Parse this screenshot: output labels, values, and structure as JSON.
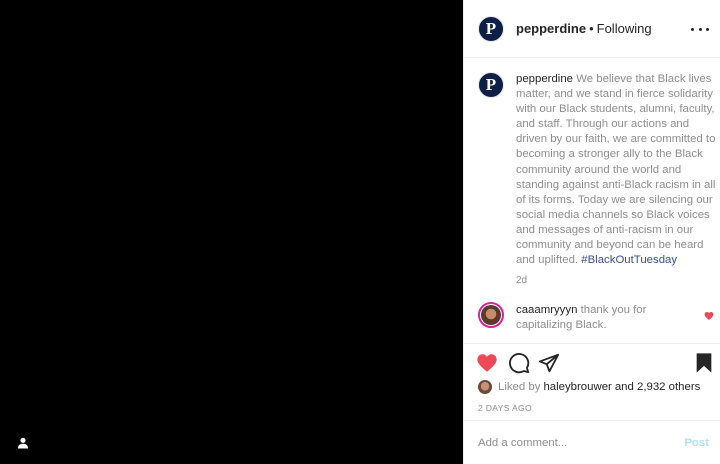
{
  "post": {
    "author": "pepperdine",
    "avatar_letter": "P",
    "follow_status": "Following",
    "separator": "•"
  },
  "caption": {
    "username": "pepperdine",
    "text": "We believe that Black lives matter, and we stand in fierce solidarity with our Black students, alumni, faculty, and staff. Through our actions and driven by our faith, we are committed to becoming a stronger ally to the Black community around the world and standing against anti-Black racism in all of its forms. Today we are silencing our social media channels so Black voices and messages of anti-racism in our community and beyond can be heard and uplifted.",
    "hashtag": "#BlackOutTuesday",
    "age": "2d"
  },
  "comments": [
    {
      "username": "caaamryyyn",
      "text": "thank you for capitalizing Black.",
      "liked": true
    }
  ],
  "likes": {
    "prefix": "Liked by",
    "user": "haleybrouwer",
    "suffix": "and 2,932 others"
  },
  "timestamp": "2 DAYS AGO",
  "add_comment": {
    "placeholder": "Add a comment...",
    "post_label": "Post"
  },
  "colors": {
    "like_red": "#ed4956",
    "hashtag_blue": "#385185",
    "post_disabled": "#b2dffc",
    "avatar_navy": "#0d1f45"
  },
  "icons": [
    "user-tag-icon",
    "more-options-icon",
    "heart-filled-icon",
    "comment-icon",
    "share-icon",
    "bookmark-icon"
  ]
}
